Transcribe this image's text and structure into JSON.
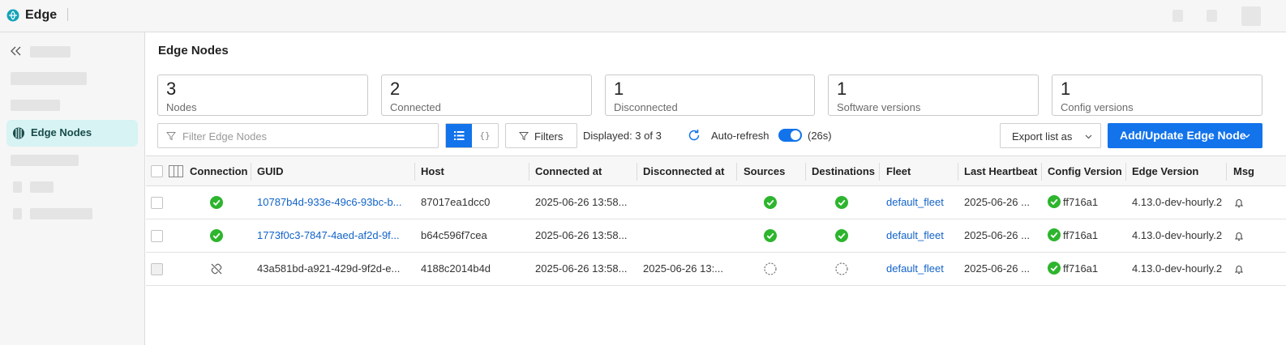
{
  "app": {
    "title": "Edge"
  },
  "sidebar": {
    "active_item": "Edge Nodes"
  },
  "page": {
    "title": "Edge Nodes"
  },
  "stats": [
    {
      "value": "3",
      "label": "Nodes"
    },
    {
      "value": "2",
      "label": "Connected"
    },
    {
      "value": "1",
      "label": "Disconnected"
    },
    {
      "value": "1",
      "label": "Software versions"
    },
    {
      "value": "1",
      "label": "Config versions"
    }
  ],
  "toolbar": {
    "filter_placeholder": "Filter Edge Nodes",
    "filters_label": "Filters",
    "displayed": "Displayed: 3 of 3",
    "auto_refresh_label": "Auto-refresh",
    "auto_refresh_on": true,
    "countdown": "(26s)",
    "export_label": "Export list as",
    "add_label": "Add/Update Edge Node",
    "json_view_glyph": "{}"
  },
  "table": {
    "headers": [
      "Connection",
      "GUID",
      "Host",
      "Connected at",
      "Disconnected at",
      "Sources",
      "Destinations",
      "Fleet",
      "Last Heartbeat",
      "Config Version",
      "Edge Version",
      "Msg"
    ],
    "rows": [
      {
        "connection": "connected",
        "guid": "10787b4d-933e-49c6-93bc-b...",
        "host": "87017ea1dcc0",
        "connected_at": "2025-06-26 13:58...",
        "disconnected_at": "",
        "sources": "ok",
        "destinations": "ok",
        "fleet": "default_fleet",
        "last_heartbeat": "2025-06-26 ...",
        "config_version": "ff716a1",
        "edge_version": "4.13.0-dev-hourly.2"
      },
      {
        "connection": "connected",
        "guid": "1773f0c3-7847-4aed-af2d-9f...",
        "host": "b64c596f7cea",
        "connected_at": "2025-06-26 13:58...",
        "disconnected_at": "",
        "sources": "ok",
        "destinations": "ok",
        "fleet": "default_fleet",
        "last_heartbeat": "2025-06-26 ...",
        "config_version": "ff716a1",
        "edge_version": "4.13.0-dev-hourly.2"
      },
      {
        "connection": "disconnected",
        "guid": "43a581bd-a921-429d-9f2d-e...",
        "host": "4188c2014b4d",
        "connected_at": "2025-06-26 13:58...",
        "disconnected_at": "2025-06-26 13:...",
        "sources": "pending",
        "destinations": "pending",
        "fleet": "default_fleet",
        "last_heartbeat": "2025-06-26 ...",
        "config_version": "ff716a1",
        "edge_version": "4.13.0-dev-hourly.2"
      }
    ]
  },
  "colors": {
    "accent": "#1273eb",
    "success": "#2db52d",
    "link": "#1263c9",
    "nav_active_bg": "#d7f3f3"
  },
  "icons": {
    "logo": "edge-logo-icon",
    "collapse": "double-chevron-left-icon",
    "nav": "edge-nodes-icon",
    "filter": "funnel-icon",
    "refresh": "refresh-icon",
    "connected": "check-circle-icon",
    "disconnected": "broken-link-icon",
    "pending": "dashed-circle-icon",
    "msg": "bell-icon"
  }
}
